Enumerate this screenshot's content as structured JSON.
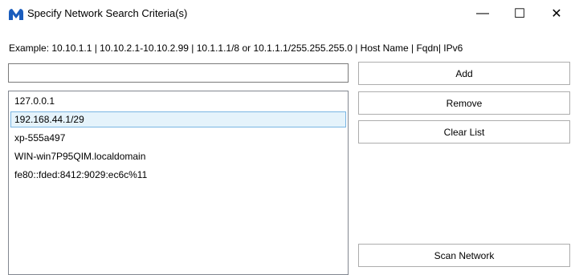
{
  "window": {
    "title": "Specify Network Search Criteria(s)",
    "minimize_glyph": "—",
    "maximize_glyph": "☐",
    "close_glyph": "✕",
    "icon": "malwarebytes-logo-icon",
    "accent": "#1a5dbd"
  },
  "example_text": "Example: 10.10.1.1 | 10.10.2.1-10.10.2.99 | 10.1.1.1/8 or 10.1.1.1/255.255.255.0 | Host Name | Fqdn| IPv6",
  "input": {
    "value": "",
    "placeholder": ""
  },
  "targets": [
    {
      "label": "127.0.0.1",
      "selected": false
    },
    {
      "label": "192.168.44.1/29",
      "selected": true
    },
    {
      "label": "xp-555a497",
      "selected": false
    },
    {
      "label": "WIN-win7P95QIM.localdomain",
      "selected": false
    },
    {
      "label": "fe80::fded:8412:9029:ec6c%11",
      "selected": false
    }
  ],
  "buttons": {
    "add": "Add",
    "remove": "Remove",
    "clear_list": "Clear List",
    "scan_network": "Scan Network"
  }
}
